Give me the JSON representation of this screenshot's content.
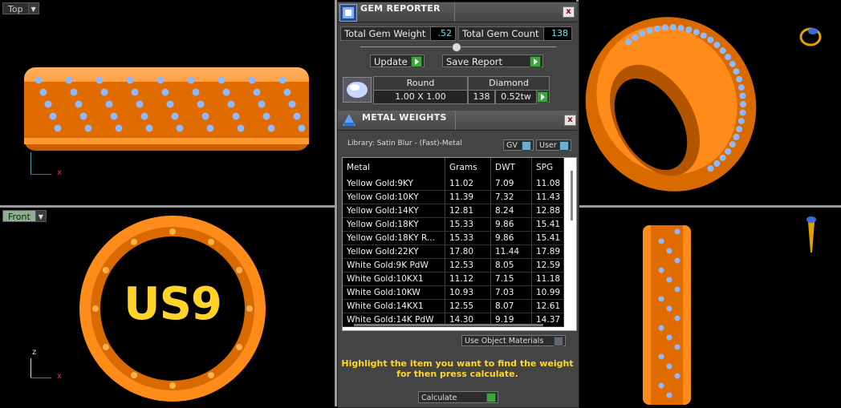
{
  "viewports": {
    "top": {
      "label": "Top"
    },
    "front": {
      "label": "Front"
    },
    "ring_engraving": "US9"
  },
  "axes": {
    "x": "x",
    "z": "z"
  },
  "gem_reporter": {
    "title": "GEM REPORTER",
    "close": "x",
    "total_weight_label": "Total Gem Weight",
    "total_weight_value": ".52",
    "total_count_label": "Total Gem Count",
    "total_count_value": "138",
    "update_label": "Update",
    "save_label": "Save Report",
    "gem_table": {
      "headers": [
        "Round",
        "Diamond"
      ],
      "size": "1.00 X 1.00",
      "count": "138",
      "weight": "0.52tw"
    }
  },
  "metal_weights": {
    "title": "METAL WEIGHTS",
    "close": "x",
    "library": "Library: Satin Blur - (Fast)-Metal",
    "gv_label": "GV",
    "user_label": "User",
    "columns": [
      "Metal",
      "Grams",
      "DWT",
      "SPG"
    ],
    "rows": [
      [
        "Yellow Gold:9KY",
        "11.02",
        "7.09",
        "11.08"
      ],
      [
        "Yellow Gold:10KY",
        "11.39",
        "7.32",
        "11.43"
      ],
      [
        "Yellow Gold:14KY",
        "12.81",
        "8.24",
        "12.88"
      ],
      [
        "Yellow Gold:18KY",
        "15.33",
        "9.86",
        "15.41"
      ],
      [
        "Yellow Gold:18KY R...",
        "15.33",
        "9.86",
        "15.41"
      ],
      [
        "Yellow Gold:22KY",
        "17.80",
        "11.44",
        "17.89"
      ],
      [
        "White Gold:9K PdW",
        "12.53",
        "8.05",
        "12.59"
      ],
      [
        "White Gold:10KX1",
        "11.12",
        "7.15",
        "11.18"
      ],
      [
        "White Gold:10KW",
        "10.93",
        "7.03",
        "10.99"
      ],
      [
        "White Gold:14KX1",
        "12.55",
        "8.07",
        "12.61"
      ],
      [
        "White Gold:14K PdW",
        "14.30",
        "9.19",
        "14.37"
      ]
    ],
    "use_object_materials": "Use Object Materials",
    "instruction_line1": "Highlight the item you want to find the weight",
    "instruction_line2": "for then press calculate.",
    "calculate_label": "Calculate"
  },
  "colors": {
    "metal": "#ff8c1a",
    "gem": "#8fb8ff",
    "engraving": "#ffd32a",
    "accent_text": "#ffd726"
  }
}
